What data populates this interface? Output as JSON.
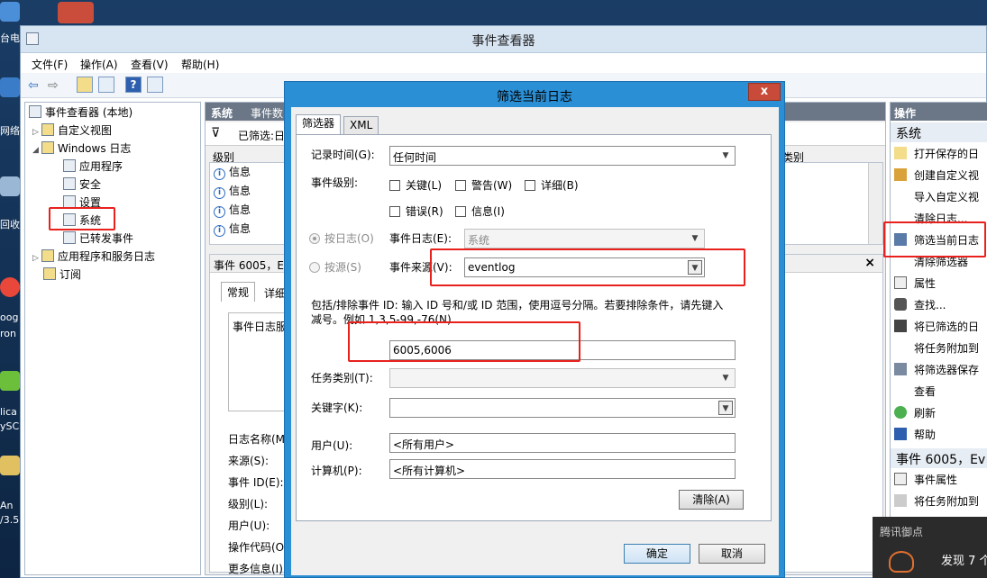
{
  "desktop": {
    "labels": [
      "台电",
      "网络",
      "回收",
      "oog",
      "ron",
      "lica",
      "ySC",
      "An",
      "/3.5"
    ]
  },
  "window": {
    "title": "事件查看器",
    "menu": [
      "文件(F)",
      "操作(A)",
      "查看(V)",
      "帮助(H)"
    ]
  },
  "tree": {
    "root": "事件查看器 (本地)",
    "custom_views": "自定义视图",
    "windows_logs": "Windows 日志",
    "application": "应用程序",
    "security": "安全",
    "setup": "设置",
    "system": "系统",
    "forwarded": "已转发事件",
    "app_service_logs": "应用程序和服务日志",
    "subscriptions": "订阅"
  },
  "middle": {
    "header_name": "系统",
    "header_count": "事件数",
    "filtered_label": "已筛选:日",
    "col_level": "级别",
    "col_category": "类别",
    "rows": [
      "信息",
      "信息",
      "信息",
      "信息"
    ],
    "detail_title": "事件 6005，Ev",
    "detail_close": "×",
    "tab_general": "常规",
    "tab_details": "详细",
    "desc_prefix": "事件日志服",
    "fields": [
      "日志名称(M",
      "来源(S):",
      "事件 ID(E):",
      "级别(L):",
      "用户(U):",
      "操作代码(O)",
      "更多信息(I):"
    ]
  },
  "actions": {
    "header": "操作",
    "section1": "系统",
    "items": [
      "打开保存的日",
      "创建自定义视",
      "导入自定义视",
      "清除日志...",
      "筛选当前日志",
      "清除筛选器",
      "属性",
      "查找...",
      "将已筛选的日",
      "将任务附加到",
      "将筛选器保存",
      "查看",
      "刷新",
      "帮助"
    ],
    "section2": "事件 6005，Ev",
    "items2": [
      "事件属性",
      "将任务附加到"
    ]
  },
  "dialog": {
    "title": "筛选当前日志",
    "close": "x",
    "tabs": [
      "筛选器",
      "XML"
    ],
    "logged_label": "记录时间(G):",
    "logged_value": "任何时间",
    "level_label": "事件级别:",
    "levels": [
      "关键(L)",
      "警告(W)",
      "详细(B)",
      "错误(R)",
      "信息(I)"
    ],
    "by_log_label": "按日志(O)",
    "by_source_label": "按源(S)",
    "event_logs_label": "事件日志(E):",
    "event_logs_value": "系统",
    "event_sources_label": "事件来源(V):",
    "event_sources_value": "eventlog",
    "id_hint_1": "包括/排除事件 ID: 输入 ID 号和/或 ID 范围，使用逗号分隔。若要排除条件，请先键入",
    "id_hint_2": "减号。例如 1,3,5-99,-76(N)",
    "event_ids_value": "6005,6006",
    "task_category_label": "任务类别(T):",
    "keywords_label": "关键字(K):",
    "user_label": "用户(U):",
    "user_value": "<所有用户>",
    "computer_label": "计算机(P):",
    "computer_value": "<所有计算机>",
    "clear_button": "清除(A)",
    "ok_button": "确定",
    "cancel_button": "取消"
  },
  "tray": {
    "title": "腾讯御点",
    "message": "发现 7 个"
  },
  "colors": {
    "highlight": "#e8211d",
    "dialog_frame": "#2b8fd6",
    "pane_header": "#6b7787"
  }
}
